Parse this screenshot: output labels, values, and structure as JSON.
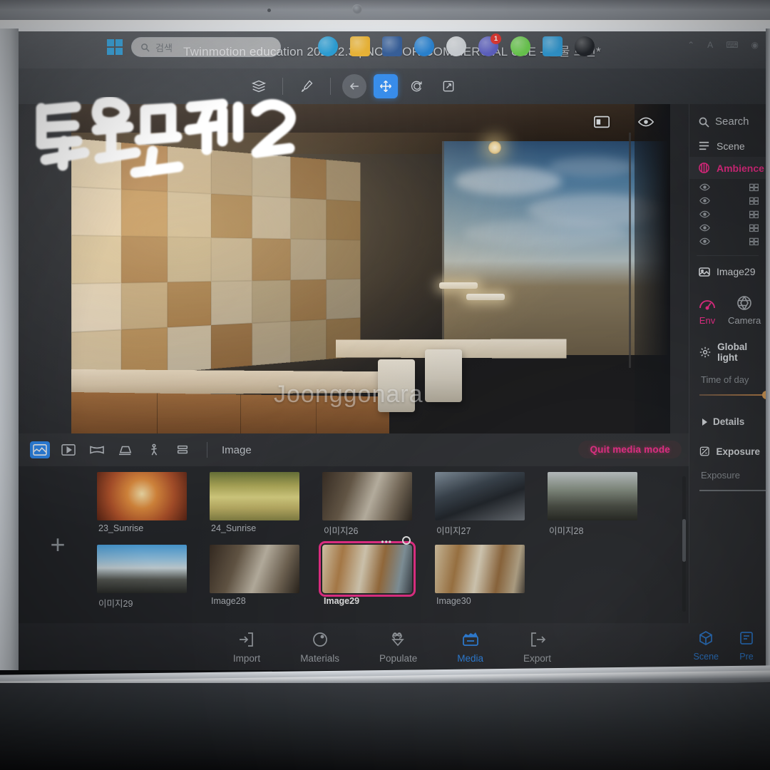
{
  "app": {
    "title": "Twinmotion education 2023.2.3 | NOT FOR COMMERCIAL USE - 건물 트윈*",
    "accent_blue": "#2d8cf5",
    "accent_pink": "#ff2f92"
  },
  "toolbar": {
    "items": [
      {
        "name": "layers-icon",
        "label": "Layers"
      },
      {
        "name": "eyedropper-icon",
        "label": "Eyedropper"
      },
      {
        "name": "back-arrow-icon",
        "label": "Back"
      },
      {
        "name": "move-tool-icon",
        "label": "Move"
      },
      {
        "name": "rotate-tool-icon",
        "label": "Rotate"
      },
      {
        "name": "scale-tool-icon",
        "label": "Scale"
      }
    ],
    "active": "move-tool-icon"
  },
  "viewport": {
    "panel_toggle_label": "Toggle panel",
    "visibility_label": "Visibility",
    "watermark": "Joonggonara",
    "handwriting": "트윈모션2"
  },
  "mediabar": {
    "tools": [
      {
        "name": "image-mode-icon",
        "label": "Image",
        "active": true
      },
      {
        "name": "video-mode-icon",
        "label": "Video",
        "active": false
      },
      {
        "name": "panorama-mode-icon",
        "label": "Panorama",
        "active": false
      },
      {
        "name": "presentation-mode-icon",
        "label": "Presentation",
        "active": false
      },
      {
        "name": "walkthrough-mode-icon",
        "label": "Walkthrough",
        "active": false
      },
      {
        "name": "stack-mode-icon",
        "label": "Stack",
        "active": false
      }
    ],
    "mode_label": "Image",
    "quit_label": "Quit media mode"
  },
  "browser": {
    "add_label": "+",
    "thumbnails": [
      {
        "caption": "23_Sunrise",
        "selected": false,
        "kind": "sunrise-orange"
      },
      {
        "caption": "24_Sunrise",
        "selected": false,
        "kind": "sunrise-yellow"
      },
      {
        "caption": "이미지26",
        "selected": false,
        "kind": "interior-dark"
      },
      {
        "caption": "이미지27",
        "selected": false,
        "kind": "lobby-blue"
      },
      {
        "caption": "이미지28",
        "selected": false,
        "kind": "exterior-dusk"
      },
      {
        "caption": "이미지29",
        "selected": false,
        "kind": "exterior-sky"
      },
      {
        "caption": "Image28",
        "selected": false,
        "kind": "interior-dark"
      },
      {
        "caption": "Image29",
        "selected": true,
        "kind": "kitchen-warm"
      },
      {
        "caption": "Image30",
        "selected": false,
        "kind": "kitchen-warm2"
      }
    ]
  },
  "rightpanel": {
    "search_placeholder": "Search",
    "scene_label": "Scene",
    "ambience_label": "Ambience",
    "tree_rows": 5,
    "selected_object": "Image29",
    "tabs": [
      {
        "label": "Env",
        "name": "tab-env",
        "active": true
      },
      {
        "label": "Camera",
        "name": "tab-camera",
        "active": false
      }
    ],
    "global_light_label": "Global light",
    "time_of_day_label": "Time of day",
    "details_label": "Details",
    "exposure_section_label": "Exposure",
    "exposure_label": "Exposure"
  },
  "bottomnav": {
    "items": [
      {
        "label": "Import",
        "name": "nav-import",
        "active": false
      },
      {
        "label": "Materials",
        "name": "nav-materials",
        "active": false
      },
      {
        "label": "Populate",
        "name": "nav-populate",
        "active": false
      },
      {
        "label": "Media",
        "name": "nav-media",
        "active": true
      },
      {
        "label": "Export",
        "name": "nav-export",
        "active": false
      }
    ],
    "right_items": [
      {
        "label": "Scene",
        "name": "nav-scene",
        "active": true
      },
      {
        "label": "Pre",
        "name": "nav-presets",
        "active": true
      }
    ]
  },
  "taskbar": {
    "search_placeholder": "검색",
    "apps": [
      {
        "name": "edge-icon",
        "color": "#1a9ad7"
      },
      {
        "name": "file-explorer-icon",
        "color": "#f0b429"
      },
      {
        "name": "office-icon",
        "color": "#2b5797"
      },
      {
        "name": "blue-app-icon",
        "color": "#1e7fd4"
      },
      {
        "name": "clip-app-icon",
        "color": "#cfd4d9"
      },
      {
        "name": "teams-icon",
        "color": "#5b5fc7",
        "badge": "1"
      },
      {
        "name": "green-app-icon",
        "color": "#6dd44f"
      },
      {
        "name": "bandizip-icon",
        "color": "#2f9fdc"
      },
      {
        "name": "twinmotion-icon",
        "color": "#20242a"
      }
    ],
    "tray": [
      {
        "name": "chevron-up-icon",
        "glyph": "⌃"
      },
      {
        "name": "ime-icon",
        "glyph": "A"
      },
      {
        "name": "keyboard-icon",
        "glyph": "⌨"
      },
      {
        "name": "wifi-icon",
        "glyph": "◉"
      }
    ]
  }
}
